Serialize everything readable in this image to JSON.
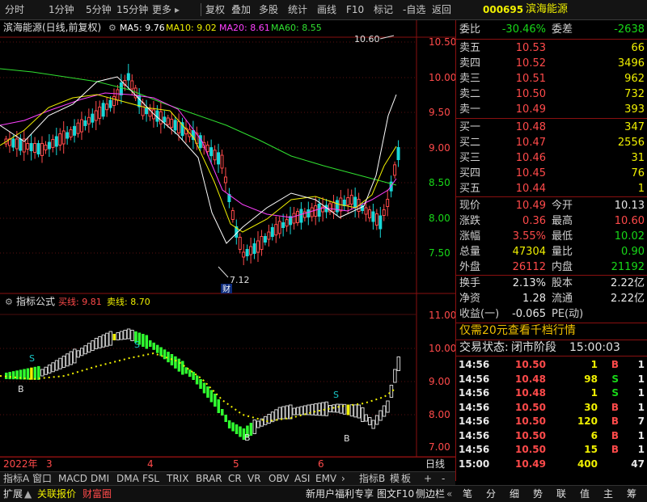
{
  "toolbar": {
    "left": [
      "分时",
      "1分钟",
      "5分钟",
      "15分钟",
      "更多"
    ],
    "right": [
      "复权",
      "叠加",
      "多股",
      "统计",
      "画线",
      "F10",
      "标记",
      "-自选",
      "返回"
    ]
  },
  "stock": {
    "code": "000695",
    "name": "滨海能源"
  },
  "main_chart": {
    "title": "滨海能源(日线,前复权)",
    "ma": [
      {
        "label": "MA5: 9.76",
        "color": "#ffffff"
      },
      {
        "label": "MA10: 9.02",
        "color": "#f0f000"
      },
      {
        "label": "MA20: 8.61",
        "color": "#ff40ff"
      },
      {
        "label": "MA60: 8.55",
        "color": "#30e030"
      }
    ],
    "price_axis": [
      "10.50",
      "10.00",
      "9.50",
      "9.00",
      "8.50",
      "8.00",
      "7.50"
    ],
    "high_label": "10.60",
    "low_label": "7.12",
    "low_badge": "财"
  },
  "indicator": {
    "title": "指标公式",
    "buy_label": "买线: 9.81",
    "sell_label": "卖线: 8.70",
    "axis": [
      "11.00",
      "10.00",
      "9.00",
      "8.00",
      "7.00"
    ],
    "b_marks": [
      "B",
      "B",
      "B"
    ],
    "s_marks": [
      "S",
      "S",
      "S"
    ]
  },
  "date_axis": {
    "year": "2022年",
    "months": [
      "3",
      "4",
      "5",
      "6"
    ],
    "period": "日线"
  },
  "bottom_tabs": [
    "指标A",
    "窗口",
    "MACD",
    "DMI",
    "DMA",
    "FSL",
    "TRIX",
    "BRAR",
    "CR",
    "VR",
    "OBV",
    "ASI",
    "EMV",
    "指标B",
    "模",
    "板",
    "+",
    "-"
  ],
  "footer": {
    "left": [
      "扩展",
      "关联报价",
      "财富圈"
    ],
    "mid": [
      "新用户福利专享",
      "图文F10",
      "侧边栏"
    ],
    "right": [
      "笔",
      "分",
      "细",
      "势",
      "联",
      "值",
      "主",
      "筹"
    ]
  },
  "quote": {
    "weibi_label": "委比",
    "weibi": "-30.46%",
    "weicha_label": "委差",
    "weicha": "-2638",
    "asks": [
      {
        "label": "卖五",
        "price": "10.53",
        "vol": "66"
      },
      {
        "label": "卖四",
        "price": "10.52",
        "vol": "3496"
      },
      {
        "label": "卖三",
        "price": "10.51",
        "vol": "962"
      },
      {
        "label": "卖二",
        "price": "10.50",
        "vol": "732"
      },
      {
        "label": "卖一",
        "price": "10.49",
        "vol": "393"
      }
    ],
    "bids": [
      {
        "label": "买一",
        "price": "10.48",
        "vol": "347"
      },
      {
        "label": "买二",
        "price": "10.47",
        "vol": "2556"
      },
      {
        "label": "买三",
        "price": "10.46",
        "vol": "31"
      },
      {
        "label": "买四",
        "price": "10.45",
        "vol": "76"
      },
      {
        "label": "买五",
        "price": "10.44",
        "vol": "1"
      }
    ],
    "stats": [
      {
        "l1": "现价",
        "v1": "10.49",
        "c1": "red",
        "l2": "今开",
        "v2": "10.13",
        "c2": "white"
      },
      {
        "l1": "涨跌",
        "v1": "0.36",
        "c1": "red",
        "l2": "最高",
        "v2": "10.60",
        "c2": "red"
      },
      {
        "l1": "涨幅",
        "v1": "3.55%",
        "c1": "red",
        "l2": "最低",
        "v2": "10.02",
        "c2": "green"
      },
      {
        "l1": "总量",
        "v1": "47304",
        "c1": "yellow",
        "l2": "量比",
        "v2": "0.90",
        "c2": "green"
      },
      {
        "l1": "外盘",
        "v1": "26112",
        "c1": "red",
        "l2": "内盘",
        "v2": "21192",
        "c2": "green"
      }
    ],
    "stats2": [
      {
        "l1": "换手",
        "v1": "2.13%",
        "l2": "股本",
        "v2": "2.22亿"
      },
      {
        "l1": "净资",
        "v1": "1.28",
        "l2": "流通",
        "v2": "2.22亿"
      },
      {
        "l1": "收益(一)",
        "v1": "-0.065",
        "l2": "PE(动)",
        "v2": ""
      }
    ],
    "promo": "仅需20元查看千档行情",
    "trade_status_label": "交易状态:",
    "trade_status": "闭市阶段",
    "trade_time": "15:00:03",
    "ticks": [
      {
        "t": "14:56",
        "p": "10.50",
        "v": "1",
        "f": "B",
        "n": "1",
        "fc": "red"
      },
      {
        "t": "14:56",
        "p": "10.48",
        "v": "98",
        "f": "S",
        "n": "1",
        "fc": "green"
      },
      {
        "t": "14:56",
        "p": "10.48",
        "v": "1",
        "f": "S",
        "n": "1",
        "fc": "green"
      },
      {
        "t": "14:56",
        "p": "10.50",
        "v": "30",
        "f": "B",
        "n": "1",
        "fc": "red"
      },
      {
        "t": "14:56",
        "p": "10.50",
        "v": "120",
        "f": "B",
        "n": "7",
        "fc": "red"
      },
      {
        "t": "14:56",
        "p": "10.50",
        "v": "6",
        "f": "B",
        "n": "1",
        "fc": "red"
      },
      {
        "t": "14:56",
        "p": "10.50",
        "v": "15",
        "f": "B",
        "n": "1",
        "fc": "red"
      },
      {
        "t": "15:00",
        "p": "10.49",
        "v": "400",
        "f": "",
        "n": "47",
        "fc": "red"
      }
    ]
  }
}
